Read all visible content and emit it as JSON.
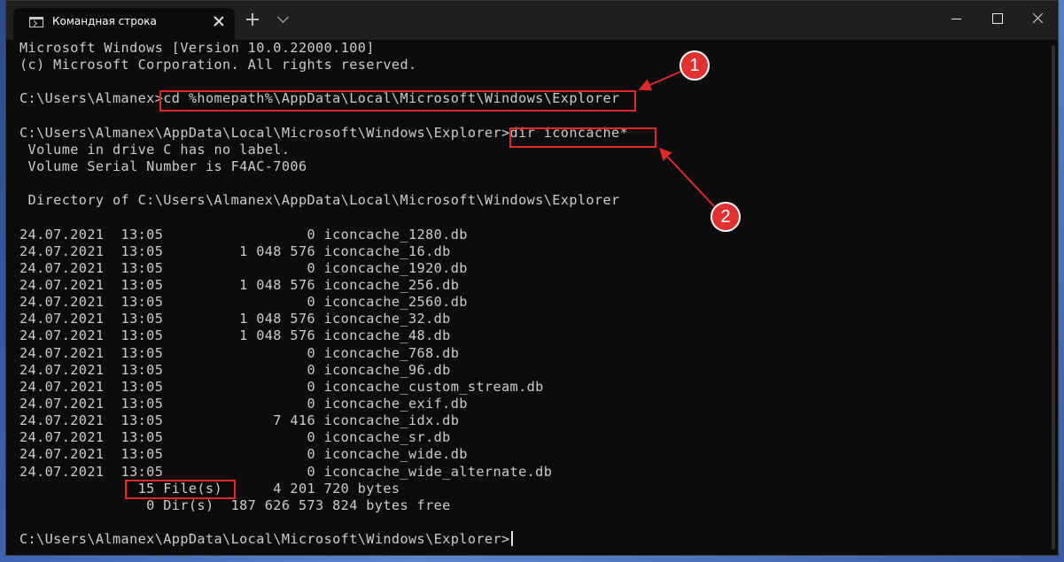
{
  "window": {
    "tab_title": "Командная строка",
    "icons": {
      "tab": "terminal-icon",
      "tab_close": "close-icon",
      "new_tab": "plus-icon",
      "dropdown": "chevron-down-icon",
      "minimize": "minimize-icon",
      "maximize": "maximize-icon",
      "close": "close-icon"
    }
  },
  "console": {
    "lines": [
      "Microsoft Windows [Version 10.0.22000.100]",
      "(c) Microsoft Corporation. All rights reserved.",
      "",
      "C:\\Users\\Almanex>cd %homepath%\\AppData\\Local\\Microsoft\\Windows\\Explorer",
      "",
      "C:\\Users\\Almanex\\AppData\\Local\\Microsoft\\Windows\\Explorer>dir iconcache*",
      " Volume in drive C has no label.",
      " Volume Serial Number is F4AC-7006",
      "",
      " Directory of C:\\Users\\Almanex\\AppData\\Local\\Microsoft\\Windows\\Explorer",
      "",
      "24.07.2021  13:05                 0 iconcache_1280.db",
      "24.07.2021  13:05         1 048 576 iconcache_16.db",
      "24.07.2021  13:05                 0 iconcache_1920.db",
      "24.07.2021  13:05         1 048 576 iconcache_256.db",
      "24.07.2021  13:05                 0 iconcache_2560.db",
      "24.07.2021  13:05         1 048 576 iconcache_32.db",
      "24.07.2021  13:05         1 048 576 iconcache_48.db",
      "24.07.2021  13:05                 0 iconcache_768.db",
      "24.07.2021  13:05                 0 iconcache_96.db",
      "24.07.2021  13:05                 0 iconcache_custom_stream.db",
      "24.07.2021  13:05                 0 iconcache_exif.db",
      "24.07.2021  13:05             7 416 iconcache_idx.db",
      "24.07.2021  13:05                 0 iconcache_sr.db",
      "24.07.2021  13:05                 0 iconcache_wide.db",
      "24.07.2021  13:05                 0 iconcache_wide_alternate.db",
      "              15 File(s)      4 201 720 bytes",
      "               0 Dir(s)  187 626 573 824 bytes free",
      "",
      "C:\\Users\\Almanex\\AppData\\Local\\Microsoft\\Windows\\Explorer>"
    ]
  },
  "annotations": {
    "marker_1": "1",
    "marker_2": "2",
    "highlight_color": "#e02a2a"
  },
  "colors": {
    "console_bg": "#0c0c0c",
    "console_text": "#cccccc",
    "titlebar_bg": "#202020"
  }
}
